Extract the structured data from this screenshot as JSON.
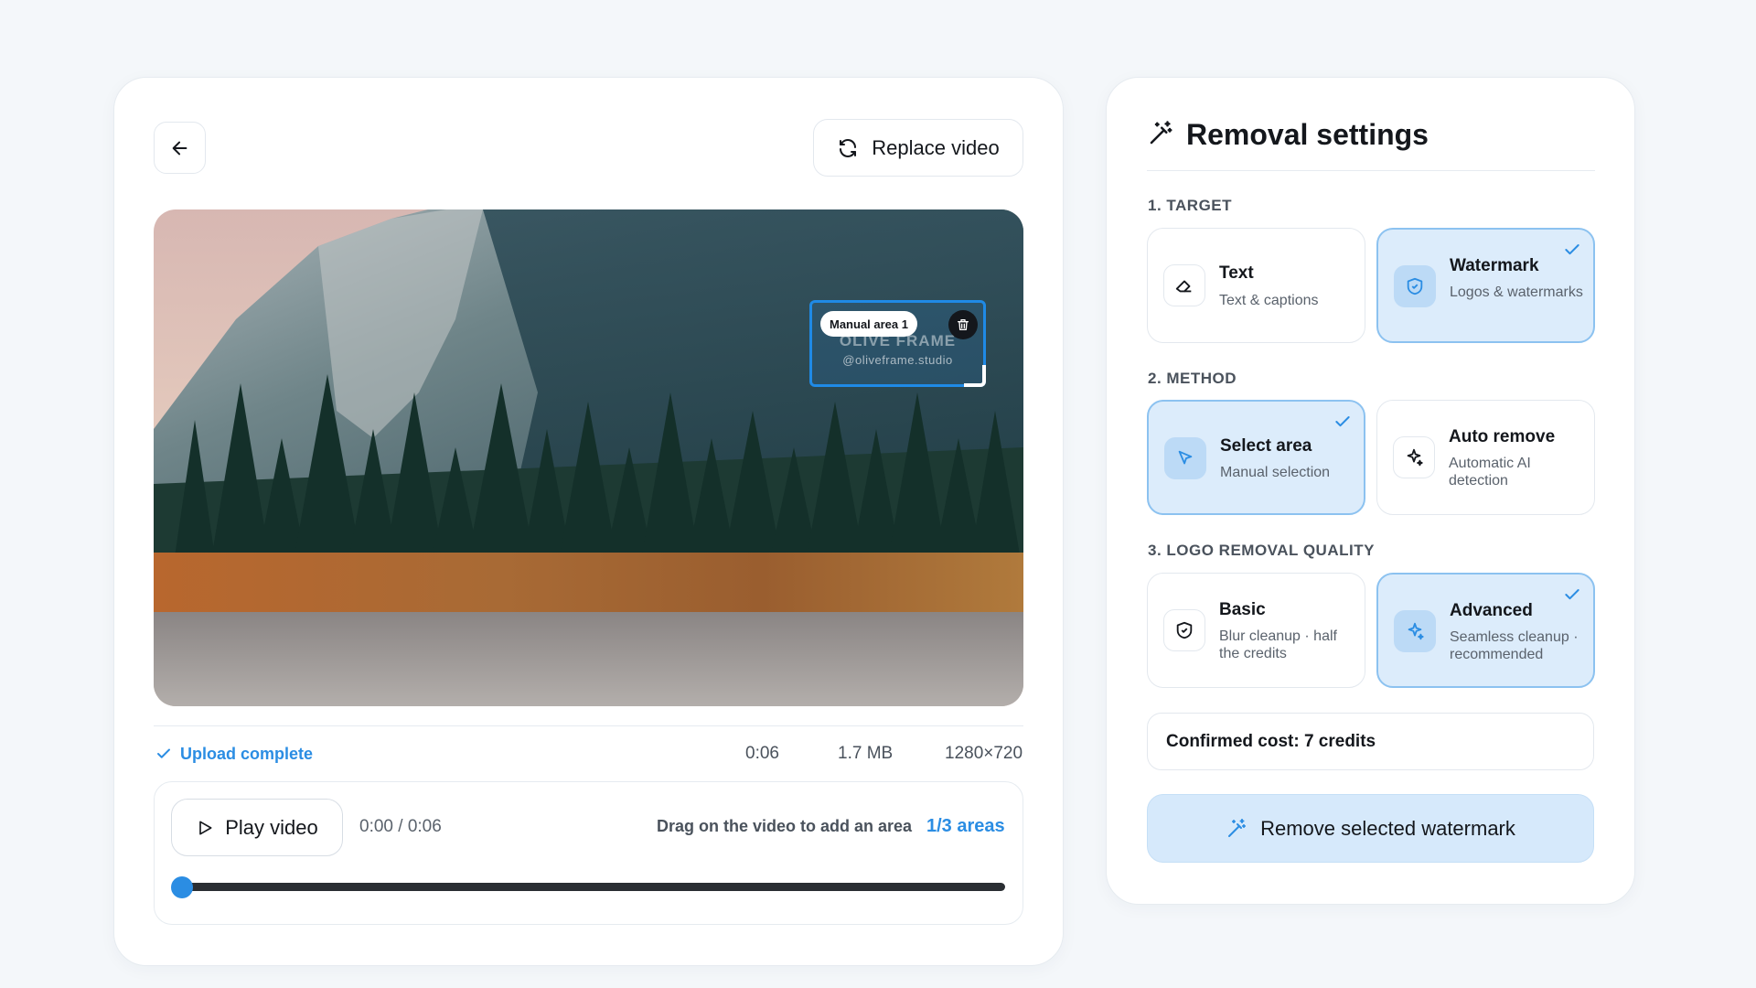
{
  "header": {
    "back_icon": "arrow-left-icon",
    "replace_label": "Replace video",
    "replace_icon": "refresh-icon"
  },
  "video": {
    "selection_label": "Manual area 1",
    "watermark_text": "OLIVE FRAME",
    "watermark_handle": "@oliveframe.studio",
    "delete_icon": "trash-icon"
  },
  "status": {
    "upload": "Upload complete",
    "duration": "0:06",
    "size": "1.7 MB",
    "resolution": "1280×720"
  },
  "controls": {
    "play_label": "Play video",
    "time": "0:00 / 0:06",
    "hint": "Drag on the video to add an area",
    "areas": "1/3 areas",
    "progress": 0
  },
  "settings": {
    "title": "Removal settings",
    "sections": [
      {
        "label": "1. TARGET",
        "options": [
          {
            "title": "Text",
            "subtitle": "Text & captions",
            "icon": "eraser-icon",
            "selected": false
          },
          {
            "title": "Watermark",
            "subtitle": "Logos & watermarks",
            "icon": "shield-icon",
            "selected": true
          }
        ]
      },
      {
        "label": "2. METHOD",
        "options": [
          {
            "title": "Select area",
            "subtitle": "Manual selection",
            "icon": "cursor-icon",
            "selected": true
          },
          {
            "title": "Auto remove",
            "subtitle": "Automatic AI detection",
            "icon": "sparkle-icon",
            "selected": false
          }
        ]
      },
      {
        "label": "3. LOGO REMOVAL QUALITY",
        "options": [
          {
            "title": "Basic",
            "subtitle": "Blur cleanup · half the credits",
            "icon": "shield-check-icon",
            "selected": false
          },
          {
            "title": "Advanced",
            "subtitle": "Seamless cleanup · recommended",
            "icon": "sparkle-icon",
            "selected": true
          }
        ]
      }
    ],
    "cost": "Confirmed cost: 7 credits",
    "action": "Remove selected watermark"
  },
  "colors": {
    "accent": "#2b8de3",
    "selected_bg": "#dcecfb",
    "selected_border": "#8cc2f0"
  }
}
